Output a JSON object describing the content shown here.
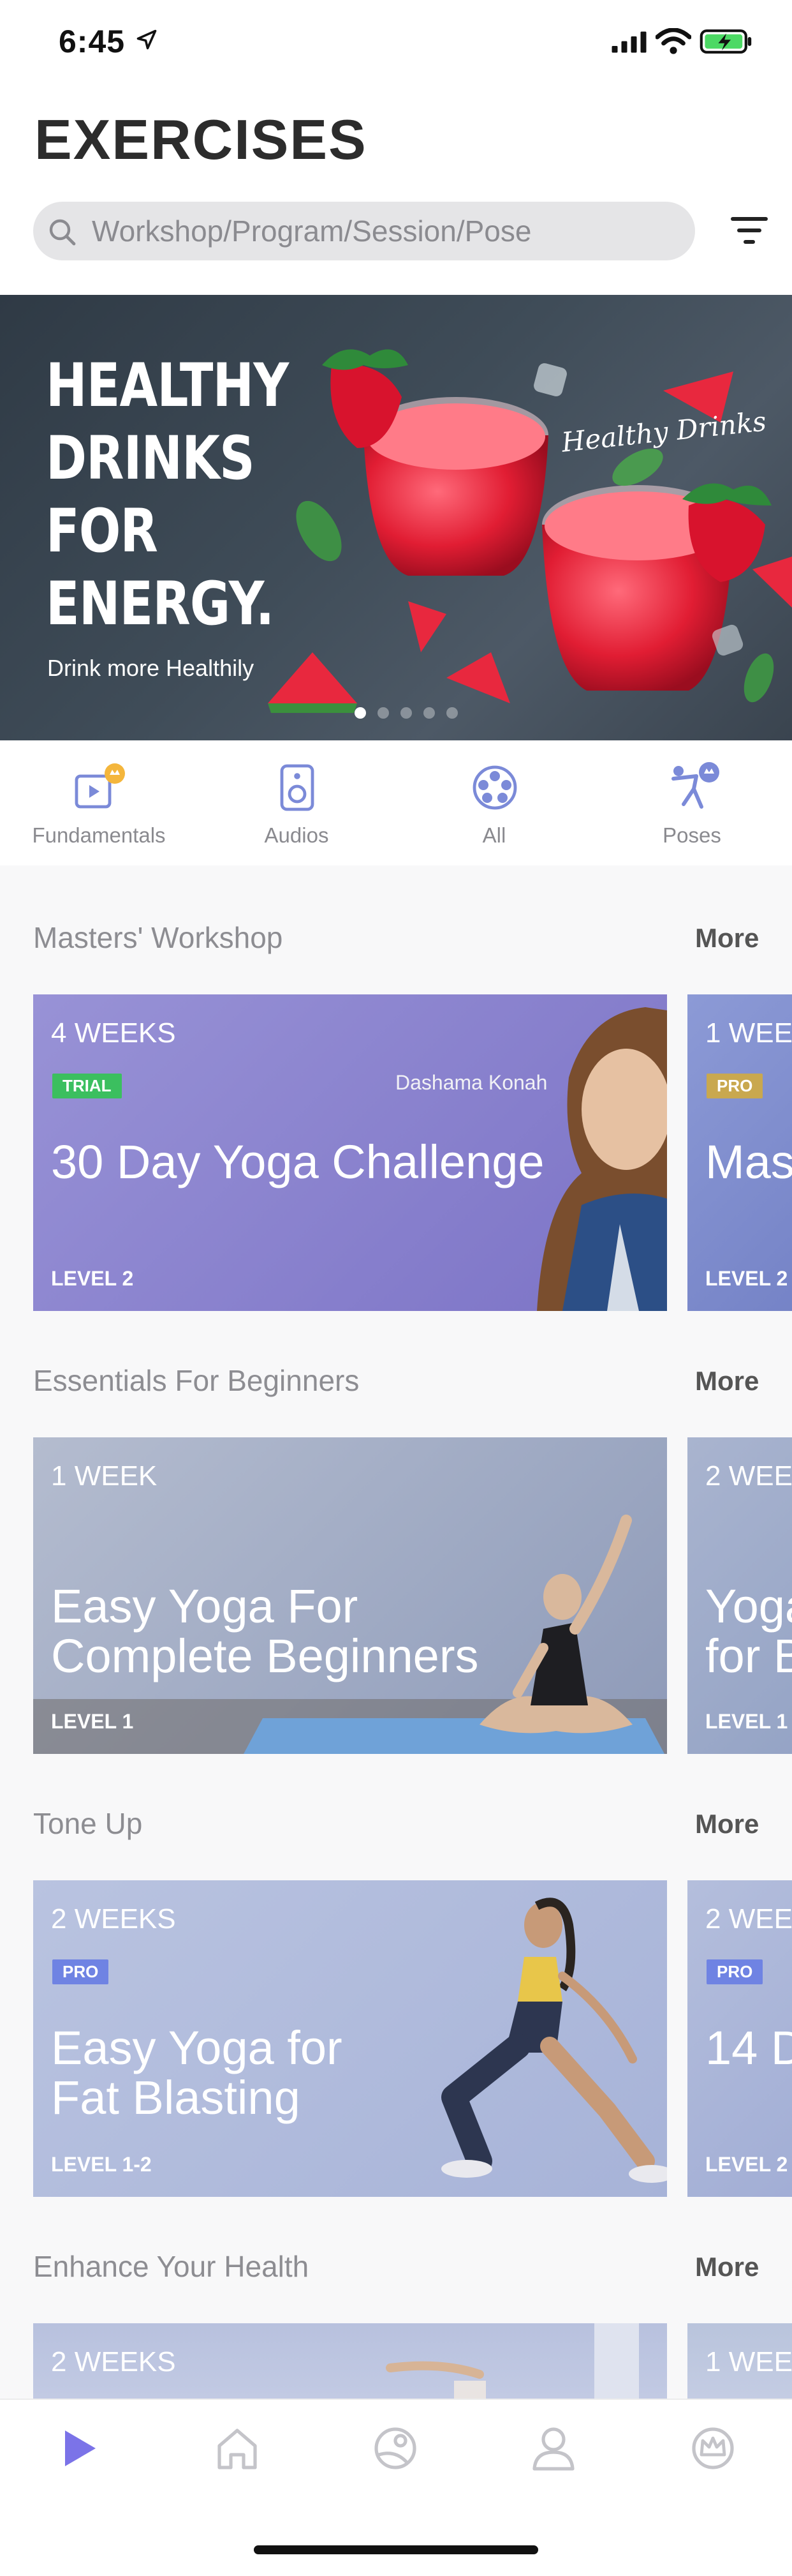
{
  "status_bar": {
    "time": "6:45"
  },
  "header": {
    "title": "EXERCISES",
    "search_placeholder": "Workshop/Program/Session/Pose"
  },
  "banner": {
    "headline": [
      "HEALTHY",
      "DRINKS",
      "FOR",
      "ENERGY."
    ],
    "script_text": "Healthy Drinks",
    "subtitle": "Drink more Healthily",
    "slide_count": 5,
    "active_slide": 1
  },
  "categories": [
    {
      "label": "Fundamentals",
      "icon": "fundamentals-icon"
    },
    {
      "label": "Audios",
      "icon": "audio-speaker-icon"
    },
    {
      "label": "All",
      "icon": "film-reel-icon"
    },
    {
      "label": "Poses",
      "icon": "pose-icon"
    }
  ],
  "sections": [
    {
      "title": "Masters' Workshop",
      "more": "More",
      "cards": [
        {
          "weeks": "4 WEEKS",
          "badge": "TRIAL",
          "author": "Dashama Konah",
          "title": "30 Day Yoga Challenge",
          "level": "LEVEL 2"
        },
        {
          "weeks": "1 WEE",
          "badge": "PRO",
          "title": "Mas",
          "level": "LEVEL 2"
        }
      ]
    },
    {
      "title": "Essentials For Beginners",
      "more": "More",
      "cards": [
        {
          "weeks": "1 WEEK",
          "title": "Easy Yoga For\nComplete Beginners",
          "level": "LEVEL 1"
        },
        {
          "weeks": "2 WEE",
          "title": "Yoga\nfor B",
          "level": "LEVEL 1"
        }
      ]
    },
    {
      "title": "Tone Up",
      "more": "More",
      "cards": [
        {
          "weeks": "2 WEEKS",
          "badge": "PRO",
          "title": "Easy Yoga for\nFat Blasting",
          "level": "LEVEL 1-2"
        },
        {
          "weeks": "2 WEE",
          "badge": "PRO",
          "title": "14 D",
          "level": "LEVEL 2"
        }
      ]
    },
    {
      "title": "Enhance Your Health",
      "more": "More",
      "cards": [
        {
          "weeks": "2 WEEKS"
        },
        {
          "weeks": "1 WEE"
        }
      ]
    }
  ],
  "tabbar": [
    {
      "icon": "play-icon",
      "active": true
    },
    {
      "icon": "home-icon",
      "active": false
    },
    {
      "icon": "discover-icon",
      "active": false
    },
    {
      "icon": "profile-icon",
      "active": false
    },
    {
      "icon": "crown-icon",
      "active": false
    }
  ],
  "colors": {
    "accent": "#7b73e8",
    "card_purple": "#8a82d0",
    "card_blue": "#a9b6da",
    "trial_green": "#3bbf5f",
    "pro_gold": "#c9a84f",
    "pro_blue": "#6f83e3"
  }
}
